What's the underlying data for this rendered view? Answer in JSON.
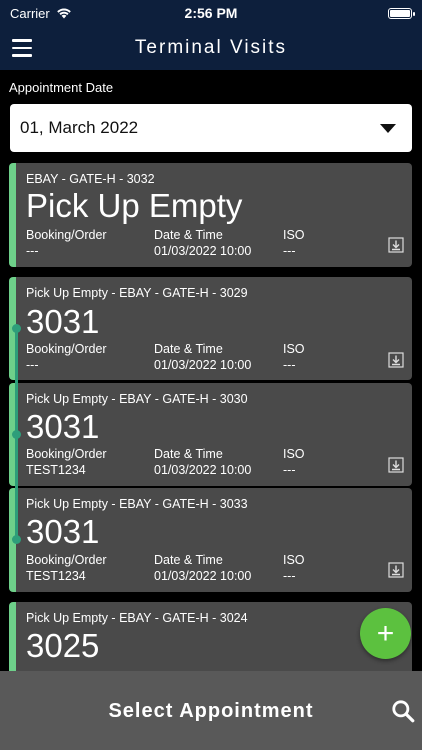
{
  "status": {
    "carrier": "Carrier",
    "time": "2:56 PM"
  },
  "nav": {
    "title": "Terminal Visits"
  },
  "filter": {
    "label": "Appointment Date",
    "date_value": "01, March 2022"
  },
  "columns": {
    "booking": "Booking/Order",
    "datetime": "Date & Time",
    "iso": "ISO"
  },
  "cards": [
    {
      "subtitle": "EBAY - GATE-H - 3032",
      "title": "Pick Up Empty",
      "booking": "---",
      "datetime": "01/03/2022 10:00",
      "iso": "---"
    },
    {
      "subtitle": "Pick Up Empty - EBAY - GATE-H - 3029",
      "title": "3031",
      "booking": "---",
      "datetime": "01/03/2022 10:00",
      "iso": "---"
    },
    {
      "subtitle": "Pick Up Empty - EBAY - GATE-H - 3030",
      "title": "3031",
      "booking": "TEST1234",
      "datetime": "01/03/2022 10:00",
      "iso": "---"
    },
    {
      "subtitle": "Pick Up Empty - EBAY - GATE-H - 3033",
      "title": "3031",
      "booking": "TEST1234",
      "datetime": "01/03/2022 10:00",
      "iso": "---"
    },
    {
      "subtitle": "Pick Up Empty - EBAY - GATE-H - 3024",
      "title": "3025",
      "booking": "",
      "datetime": "",
      "iso": ""
    }
  ],
  "fab": {
    "symbol": "+"
  },
  "bottom": {
    "title": "Select Appointment"
  },
  "colors": {
    "nav_bg": "#0d1f3c",
    "card_bg": "#4a4a4a",
    "accent_green": "#6ed08a",
    "timeline_teal": "#2e9e7a",
    "fab_green": "#5cc13f",
    "bottom_bg": "#595959"
  }
}
